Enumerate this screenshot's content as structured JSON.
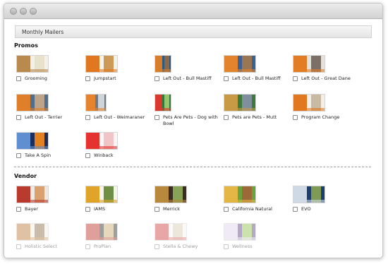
{
  "header": {
    "title": "Monthly Mailers"
  },
  "sections": [
    {
      "title": "Promos"
    },
    {
      "title": "Vendor"
    }
  ],
  "promos": [
    {
      "label": "Grooming",
      "icon": "mailer-thumbnail-grooming-icon",
      "colors": [
        "#f3f1e8",
        "#b98a4e",
        "#e8e2cc"
      ]
    },
    {
      "label": "Jumpstart",
      "icon": "mailer-thumbnail-jumpstart-icon",
      "colors": [
        "#f6f2ea",
        "#e1781f",
        "#ce9a58"
      ]
    },
    {
      "label": "Left Out - Bull Mastiff",
      "icon": "mailer-thumbnail-dog-icon",
      "colors": [
        "#2e5a80",
        "#d87d2a",
        "#8b6a4a"
      ]
    },
    {
      "label": "Left Out - Bull Mastiff",
      "icon": "mailer-thumbnail-dog-icon",
      "colors": [
        "#3b6290",
        "#e3832e",
        "#9a7653"
      ]
    },
    {
      "label": "Left Out - Great Dane",
      "icon": "mailer-thumbnail-dog-icon",
      "colors": [
        "#e5e2dc",
        "#e27d25",
        "#7c7066"
      ]
    },
    {
      "label": "Left Out - Terrier",
      "icon": "mailer-thumbnail-dog-icon",
      "colors": [
        "#4f6f8d",
        "#e07f29",
        "#bda38a"
      ]
    },
    {
      "label": "Left Out - Weimaraner",
      "icon": "mailer-thumbnail-dog-icon",
      "colors": [
        "#6e7b86",
        "#e5842d",
        "#cfd4d8"
      ]
    },
    {
      "label": "Pets Are Pets - Dog with Bowl",
      "icon": "mailer-thumbnail-dog-bowl-icon",
      "colors": [
        "#2c7d3a",
        "#d93a2e",
        "#98c46a"
      ]
    },
    {
      "label": "Pets are Pets - Mutt",
      "icon": "mailer-thumbnail-mutt-icon",
      "colors": [
        "#3e7b3a",
        "#c89a45",
        "#7f8f9d"
      ]
    },
    {
      "label": "Program Change",
      "icon": "mailer-thumbnail-program-change-icon",
      "colors": [
        "#f3efe6",
        "#e1781f",
        "#c8b9a2"
      ]
    },
    {
      "label": "Take A Spin",
      "icon": "mailer-thumbnail-take-a-spin-icon",
      "colors": [
        "#1c2d5c",
        "#5f8fd0",
        "#e2811f"
      ]
    },
    {
      "label": "Winback",
      "icon": "mailer-thumbnail-winback-icon",
      "colors": [
        "#fbf5f5",
        "#e5322e",
        "#f1c5c5"
      ]
    }
  ],
  "vendors": [
    {
      "label": "Bayer",
      "icon": "vendor-thumbnail-bayer-icon",
      "colors": [
        "#efe9e2",
        "#b93b2d",
        "#d9a070"
      ],
      "faded": false
    },
    {
      "label": "IAMS",
      "icon": "vendor-thumbnail-iams-icon",
      "colors": [
        "#f7f3e8",
        "#e0a528",
        "#6f8f45"
      ],
      "faded": false
    },
    {
      "label": "Merrick",
      "icon": "vendor-thumbnail-merrick-icon",
      "colors": [
        "#3a2c22",
        "#b8893d",
        "#88a355"
      ],
      "faded": false
    },
    {
      "label": "California Natural",
      "icon": "vendor-thumbnail-california-natural-icon",
      "colors": [
        "#6aa23b",
        "#e3b645",
        "#9c6a39"
      ],
      "faded": false
    },
    {
      "label": "EVO",
      "icon": "vendor-thumbnail-evo-icon",
      "colors": [
        "#1e3f6e",
        "#cfd9e6",
        "#7e9a54"
      ],
      "faded": false
    },
    {
      "label": "Holistic Select",
      "icon": "vendor-thumbnail-holistic-select-icon",
      "colors": [
        "#f3ede4",
        "#b87a34",
        "#8e6a44"
      ],
      "faded": true
    },
    {
      "label": "ProPlan",
      "icon": "vendor-thumbnail-proplan-icon",
      "colors": [
        "#2a2a2a",
        "#b92d22",
        "#c7a96b"
      ],
      "faded": true
    },
    {
      "label": "Stella & Chewy",
      "icon": "vendor-thumbnail-stella-chewy-icon",
      "colors": [
        "#f7f5f2",
        "#cf3b3b",
        "#d9c9b0"
      ],
      "faded": true
    },
    {
      "label": "Wellness",
      "icon": "vendor-thumbnail-wellness-icon",
      "colors": [
        "#5a3f82",
        "#dcd2e8",
        "#8fbf4a"
      ],
      "faded": true
    }
  ]
}
